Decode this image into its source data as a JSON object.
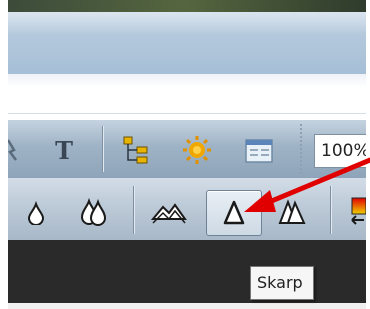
{
  "toolbar_top": {
    "tools": [
      {
        "name": "pointer-tool",
        "icon": "cursor-icon"
      },
      {
        "name": "text-tool",
        "label": "T",
        "icon": "text-icon"
      },
      {
        "name": "tree-tool",
        "icon": "hierarchy-icon"
      },
      {
        "name": "sun-tool",
        "icon": "sun-icon"
      },
      {
        "name": "window-tool",
        "icon": "window-icon"
      }
    ],
    "zoom_value": "100%"
  },
  "toolbar_bottom": {
    "tools": [
      {
        "name": "drop-small",
        "icon": "drop-icon"
      },
      {
        "name": "drop-double",
        "icon": "double-drop-icon"
      },
      {
        "name": "mountains",
        "icon": "mountain-icon"
      },
      {
        "name": "sharpen",
        "icon": "sharp-cone-icon",
        "pressed": true
      },
      {
        "name": "sharpen-more",
        "icon": "double-cone-icon"
      },
      {
        "name": "gradient-swap",
        "icon": "gradient-icon"
      }
    ]
  },
  "tooltip": {
    "text": "Skarp"
  },
  "colors": {
    "arrow": "#e00000",
    "toolbar": "#a8b8c8",
    "dark_area": "#2a2a2a"
  }
}
